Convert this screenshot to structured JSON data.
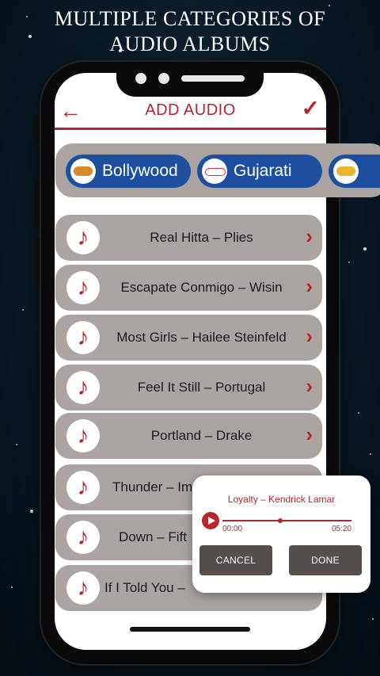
{
  "banner": {
    "line1": "MULTIPLE CATEGORIES OF",
    "line2": "AUDIO ALBUMS"
  },
  "header": {
    "back_icon": "arrow-left-icon",
    "title": "ADD AUDIO",
    "confirm_icon": "checkmark-icon",
    "accent_color": "#b8252b"
  },
  "categories": [
    {
      "label": "Bollywood",
      "icon": "bollywood-logo-icon"
    },
    {
      "label": "Gujarati",
      "icon": "gujarati-logo-icon"
    },
    {
      "label": "",
      "icon": "bhojpuri-logo-icon"
    }
  ],
  "songs": [
    {
      "label": "Real Hitta – Plies"
    },
    {
      "label": "Escapate Conmigo – Wisin"
    },
    {
      "label": "Most Girls – Hailee Steinfeld"
    },
    {
      "label": "Feel It Still – Portugal"
    },
    {
      "label": "Portland – Drake"
    },
    {
      "label": "Thunder – Im"
    },
    {
      "label": "Down – Fift"
    },
    {
      "label": "If I Told You –"
    }
  ],
  "player_dialog": {
    "song_title": "Loyalty – Kendrick Lamar",
    "current_time": "00:00",
    "total_time": "05:20",
    "progress": 0.45,
    "cancel_label": "CANCEL",
    "done_label": "DONE"
  }
}
